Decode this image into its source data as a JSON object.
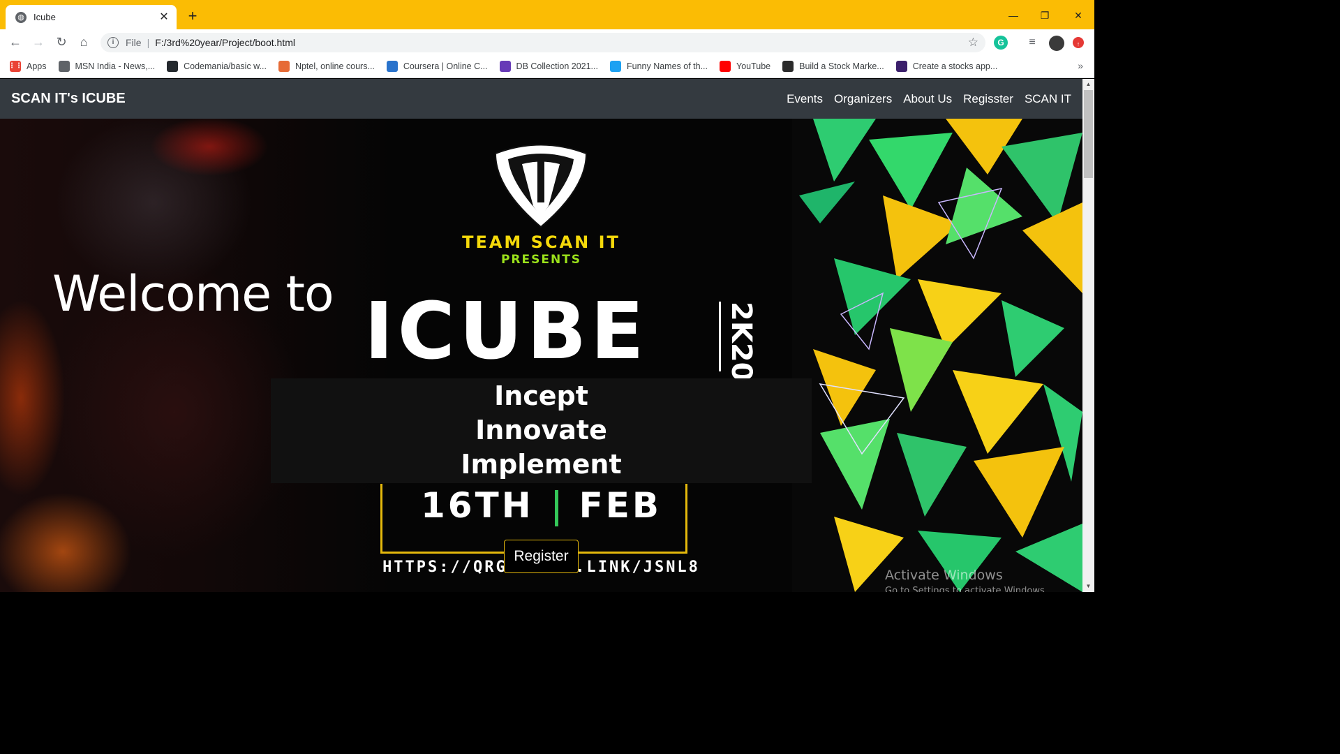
{
  "browser": {
    "tab_title": "Icube",
    "url_scheme": "File",
    "url_path": "F:/3rd%20year/Project/boot.html",
    "bookmarks": [
      {
        "label": "Apps",
        "color": "#ea4335"
      },
      {
        "label": "MSN India - News,...",
        "color": "#5f6368"
      },
      {
        "label": "Codemania/basic w...",
        "color": "#24292e"
      },
      {
        "label": "Nptel, online cours...",
        "color": "#e66b36"
      },
      {
        "label": "Coursera | Online C...",
        "color": "#2a73cc"
      },
      {
        "label": "DB Collection 2021...",
        "color": "#673ab7"
      },
      {
        "label": "Funny Names of th...",
        "color": "#1da1f2"
      },
      {
        "label": "YouTube",
        "color": "#ff0000"
      },
      {
        "label": "Build a Stock Marke...",
        "color": "#2b2b2b"
      },
      {
        "label": "Create a stocks app...",
        "color": "#3b1f6b"
      }
    ]
  },
  "navbar": {
    "brand": "SCAN IT's ICUBE",
    "links": [
      "Events",
      "Organizers",
      "About Us",
      "Regisster",
      "SCAN IT"
    ]
  },
  "hero": {
    "welcome": "Welcome to",
    "team": "TEAM SCAN IT",
    "presents": "PRESENTS",
    "event_name": "ICUBE",
    "event_year": "2K20",
    "taglines": [
      "Incept",
      "Innovate",
      "Implement"
    ],
    "date_day": "16TH",
    "date_month": "FEB",
    "link_text": "HTTPS://QRGO.PAGE.LINK/JSNL8",
    "register_label": "Register"
  },
  "watermark": {
    "line1": "Activate Windows",
    "line2": "Go to Settings to activate Windows."
  },
  "colors": {
    "tabstrip": "#fbbc04",
    "navbar": "#343a40",
    "accent_yellow": "#f5d90a",
    "accent_green": "#9be21b"
  }
}
